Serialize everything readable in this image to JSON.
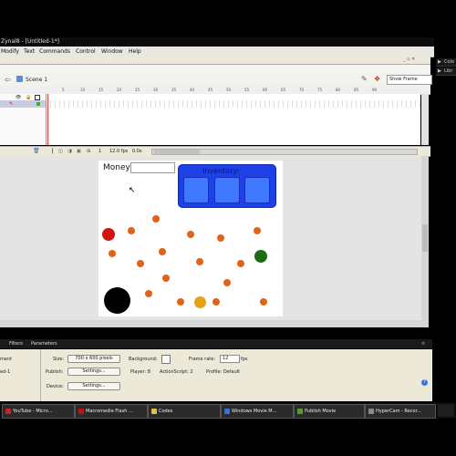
{
  "window": {
    "title": "Zynal8 - [Untitled-1*]"
  },
  "menu": [
    "Modify",
    "Text",
    "Commands",
    "Control",
    "Window",
    "Help"
  ],
  "right_panel": {
    "items": [
      "Colo",
      "Libr"
    ]
  },
  "timeline": {
    "scene": "Scene 1",
    "view_dropdown": "Show Frame",
    "frame_numbers": [
      "5",
      "10",
      "15",
      "20",
      "25",
      "30",
      "35",
      "40",
      "45",
      "50",
      "55",
      "60",
      "65",
      "70",
      "75",
      "80",
      "85",
      "90"
    ],
    "current_frame": "1",
    "fps": "12.0 fps",
    "elapsed": "0.0s"
  },
  "stage": {
    "money_label": "Money:",
    "inventory_label": "Inventory:",
    "dots": [
      {
        "color": "#d0150e",
        "size": "large"
      },
      {
        "color": "#e0631a",
        "size": "small"
      },
      {
        "color": "#e0631a",
        "size": "small"
      },
      {
        "color": "#e0631a",
        "size": "small"
      },
      {
        "color": "#e0631a",
        "size": "small"
      },
      {
        "color": "#e0631a",
        "size": "small"
      },
      {
        "color": "#e0631a",
        "size": "small"
      },
      {
        "color": "#e0631a",
        "size": "small"
      },
      {
        "color": "#e0631a",
        "size": "small"
      },
      {
        "color": "#e0631a",
        "size": "small"
      },
      {
        "color": "#e0631a",
        "size": "small"
      },
      {
        "color": "#e0631a",
        "size": "small"
      },
      {
        "color": "#e0631a",
        "size": "small"
      },
      {
        "color": "#e0631a",
        "size": "small"
      },
      {
        "color": "#e0631a",
        "size": "small"
      },
      {
        "color": "#e0631a",
        "size": "small"
      },
      {
        "color": "#e0631a",
        "size": "small"
      },
      {
        "color": "#1e6b16",
        "size": "large"
      },
      {
        "color": "#000000",
        "size": "xlarge"
      },
      {
        "color": "#e8a013",
        "size": "medium"
      }
    ]
  },
  "properties": {
    "tabs": [
      "Filters",
      "Parameters"
    ],
    "left_labels": [
      "ment",
      "ed-1"
    ],
    "size_label": "Size:",
    "size_value": "700 x 600 pixels",
    "background_label": "Background:",
    "frame_rate_label": "Frame rate:",
    "frame_rate_value": "12",
    "fps_unit": "fps",
    "publish_label": "Publish:",
    "settings_button": "Settings...",
    "player_label": "Player: 8",
    "actionscript_label": "ActionScript: 2",
    "profile_label": "Profile: Default",
    "device_label": "Device:"
  },
  "taskbar": [
    {
      "label": "YouTube - Micro...",
      "icon_color": "#cc2222"
    },
    {
      "label": "Macromedia Flash ...",
      "icon_color": "#c41010"
    },
    {
      "label": "Codes",
      "icon_color": "#e2c04a"
    },
    {
      "label": "Windows Movie M...",
      "icon_color": "#3a73c9"
    },
    {
      "label": "Publish Movie",
      "icon_color": "#5a9a2a"
    },
    {
      "label": "HyperCam - Recor...",
      "icon_color": "#8a8a8a"
    }
  ],
  "colors": {
    "inventory": "#1d41e6",
    "inventory_slot": "#3e78ff",
    "stage_bg": "#ffffff"
  }
}
